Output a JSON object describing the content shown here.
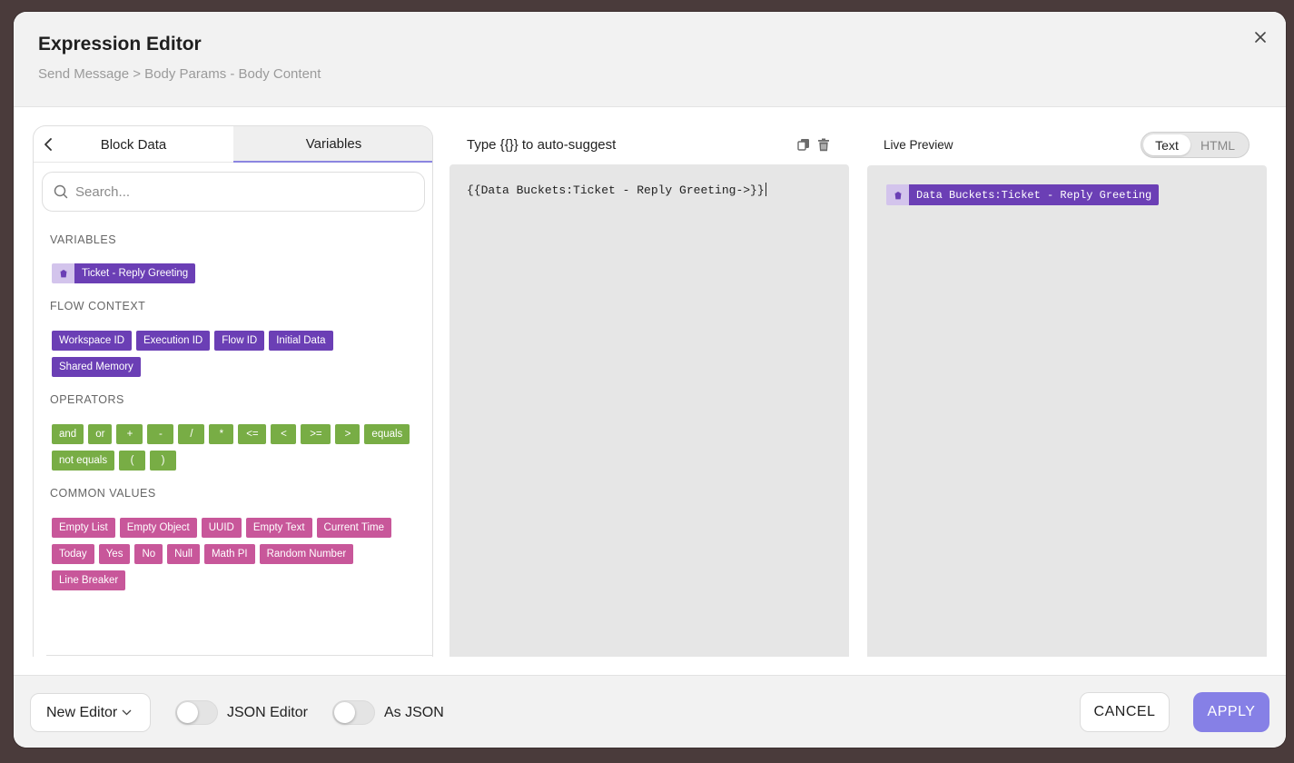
{
  "modal": {
    "title": "Expression Editor",
    "subtitle": "Send Message > Body Params - Body Content"
  },
  "left": {
    "tabs": [
      {
        "label": "Block Data",
        "active": false
      },
      {
        "label": "Variables",
        "active": true
      }
    ],
    "search_placeholder": "Search...",
    "sections": {
      "variables": {
        "title": "VARIABLES",
        "items": [
          "Ticket - Reply Greeting"
        ]
      },
      "flow_context": {
        "title": "FLOW CONTEXT",
        "items": [
          "Workspace ID",
          "Execution ID",
          "Flow ID",
          "Initial Data",
          "Shared Memory"
        ]
      },
      "operators": {
        "title": "OPERATORS",
        "items": [
          "and",
          "or",
          "+",
          "-",
          "/",
          "*",
          "<=",
          "<",
          ">=",
          ">",
          "equals",
          "not equals",
          "(",
          ")"
        ]
      },
      "common_values": {
        "title": "COMMON VALUES",
        "items": [
          "Empty List",
          "Empty Object",
          "UUID",
          "Empty Text",
          "Current Time",
          "Today",
          "Yes",
          "No",
          "Null",
          "Math PI",
          "Random Number",
          "Line Breaker"
        ]
      }
    }
  },
  "editor": {
    "hint": "Type {{}} to auto-suggest",
    "content": "{{Data Buckets:Ticket - Reply Greeting->}}"
  },
  "preview": {
    "title": "Live Preview",
    "modes": [
      "Text",
      "HTML"
    ],
    "active_mode": "Text",
    "chip_text": "Data Buckets:Ticket - Reply Greeting"
  },
  "footer": {
    "editor_select": "New Editor",
    "json_editor_label": "JSON Editor",
    "json_editor_on": false,
    "as_json_label": "As JSON",
    "as_json_on": false,
    "cancel_label": "CANCEL",
    "apply_label": "APPLY"
  },
  "colors": {
    "purple_chip": "#6b3fb5",
    "green_chip": "#78ad45",
    "pink_chip": "#c8579a",
    "accent": "#8680e6"
  }
}
